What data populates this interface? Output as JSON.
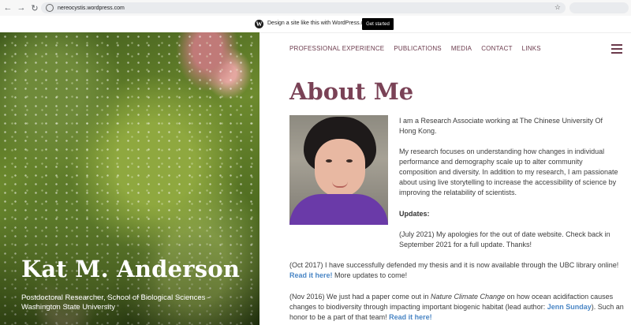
{
  "browser": {
    "url": "nereocystis.wordpress.com",
    "back_icon": "←",
    "forward_icon": "→",
    "reload_icon": "↻",
    "star_icon": "☆"
  },
  "banner": {
    "logo_letter": "W",
    "text": "Design a site like this with WordPress.com",
    "cta": "Get started"
  },
  "hero": {
    "name": "Kat M. Anderson",
    "subtitle": "Postdoctoral Researcher, School of Biological Sciences - Washington State University"
  },
  "nav": {
    "items": [
      "PROFESSIONAL EXPERIENCE",
      "PUBLICATIONS",
      "MEDIA",
      "CONTACT",
      "LINKS"
    ],
    "menu_icon": "hamburger-icon"
  },
  "page": {
    "title": "About Me",
    "intro": "I am a Research Associate working at The Chinese University Of Hong Kong.",
    "research": "My research focuses on understanding how changes in individual performance and demography scale up to alter community composition and diversity. In addition to my research, I am passionate about using live storytelling to increase the accessibility of science by improving the relatability of scientists.",
    "updates_heading": "Updates:",
    "update_2021": "(July 2021) My apologies for the out of date website. Check back in September 2021 for a full update. Thanks!",
    "update_2017_a": "(Oct 2017) I have successfully defended my thesis and it is now available through the UBC library online!",
    "update_2017_link": "Read it here!",
    "update_2017_b": "More updates to come!",
    "update_2016_a": "(Nov 2016) We just had a paper come out in",
    "update_2016_journal": "Nature Climate Change",
    "update_2016_b": "on how ocean acidifaction causes changes to biodiversity through impacting important biogenic habitat (lead author:",
    "update_2016_author": "Jenn Sunday",
    "update_2016_c": "). Such an honor to be a part of that team!",
    "update_2016_link": "Read it here!"
  },
  "colors": {
    "accent": "#7a4256",
    "link": "#4a86c5"
  }
}
